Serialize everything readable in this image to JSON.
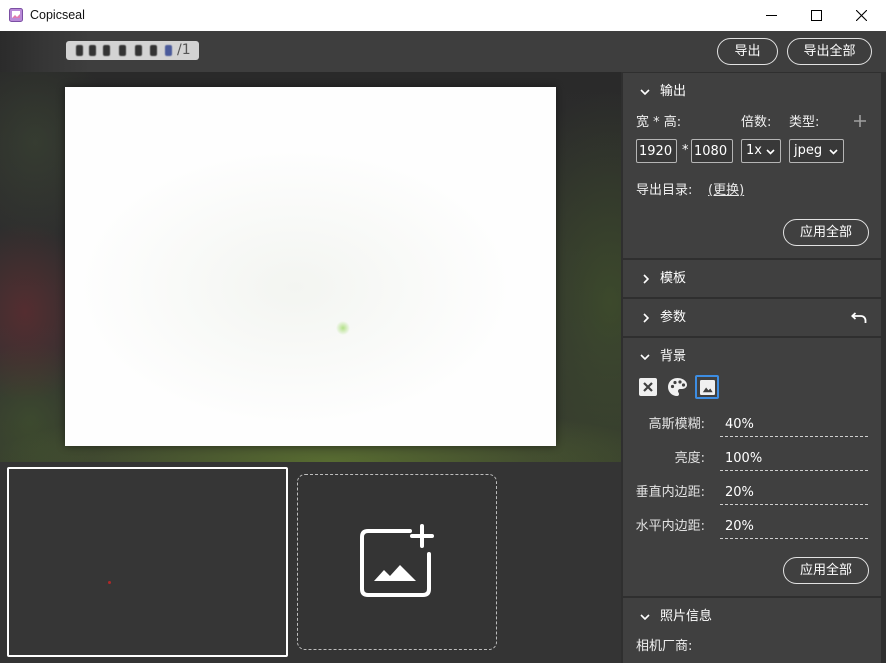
{
  "window": {
    "title": "Copicseal",
    "icon": "app-icon",
    "controls": [
      "minimize-icon",
      "maximize-icon",
      "close-icon"
    ]
  },
  "toolbar": {
    "page_indicator": "/1",
    "export_label": "导出",
    "export_all_label": "导出全部"
  },
  "thumbnails": {
    "selected_index": 0,
    "add_icon": "add-image-icon"
  },
  "panel": {
    "output": {
      "title": "输出",
      "expanded": true,
      "size_label": "宽 * 高:",
      "scale_label": "倍数:",
      "type_label": "类型:",
      "add_icon": "plus-icon",
      "width": "1920",
      "size_separator": "*",
      "height": "1080",
      "scale": "1x",
      "type": "jpeg",
      "dir_label": "导出目录:",
      "change_dir": "(更换)",
      "apply_all": "应用全部"
    },
    "template": {
      "title": "模板",
      "expanded": false
    },
    "params": {
      "title": "参数",
      "expanded": false,
      "reset_icon": "undo-icon"
    },
    "background": {
      "title": "背景",
      "expanded": true,
      "modes": [
        "no-background-icon",
        "palette-icon",
        "image-icon"
      ],
      "selected_mode": "image-icon",
      "fields": [
        {
          "label": "高斯模糊:",
          "value": "40%"
        },
        {
          "label": "亮度:",
          "value": "100%"
        },
        {
          "label": "垂直内边距:",
          "value": "20%"
        },
        {
          "label": "水平内边距:",
          "value": "20%"
        }
      ],
      "apply_all": "应用全部"
    },
    "photo_info": {
      "title": "照片信息",
      "expanded": true,
      "fields": [
        {
          "label": "相机厂商:"
        }
      ]
    }
  },
  "colors": {
    "accent": "#3d8de2",
    "panel_section": "#404040",
    "toolbar": "#3e3e3e",
    "title_bar": "#ffffff"
  }
}
